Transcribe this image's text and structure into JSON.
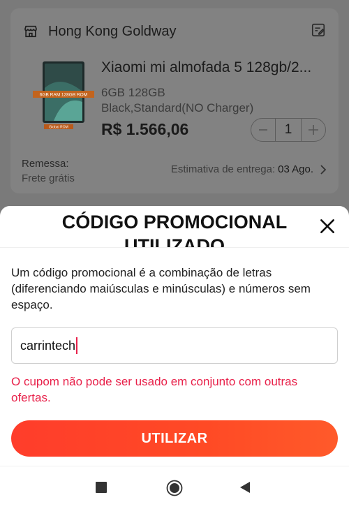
{
  "order": {
    "store_name": "Hong Kong Goldway",
    "product": {
      "title": "Xiaomi mi almofada 5 128gb/2...",
      "variant": "6GB 128GB Black,Standard(NO Charger)",
      "price": "R$ 1.566,06",
      "image_banner": "6GB RAM 128GB ROM",
      "image_badge": "Global ROM",
      "quantity": "1"
    },
    "shipping": {
      "label": "Remessa:",
      "value": "Frete grátis"
    },
    "delivery": {
      "label": "Estimativa de entrega:",
      "date": "03 Ago."
    }
  },
  "promo_sheet": {
    "title": "CÓDIGO PROMOCIONAL UTILIZADO",
    "description": "Um código promocional é a combinação de letras (diferenciando maiúsculas e minúsculas) e números sem espaço.",
    "input_value": "carrintech",
    "error_message": "O cupom não pode ser usado em conjunto com outras ofertas.",
    "apply_label": "UTILIZAR"
  },
  "colors": {
    "accent": "#ff4128",
    "error": "#e8214a",
    "overlay": "#7b7b7b"
  },
  "icons": {
    "store": "store-icon",
    "edit": "edit-note-icon",
    "close": "close-icon",
    "minus": "minus-icon",
    "plus": "plus-icon",
    "chevron": "chevron-right-icon",
    "nav_recent": "recent-apps-icon",
    "nav_home": "home-icon",
    "nav_back": "back-icon"
  }
}
